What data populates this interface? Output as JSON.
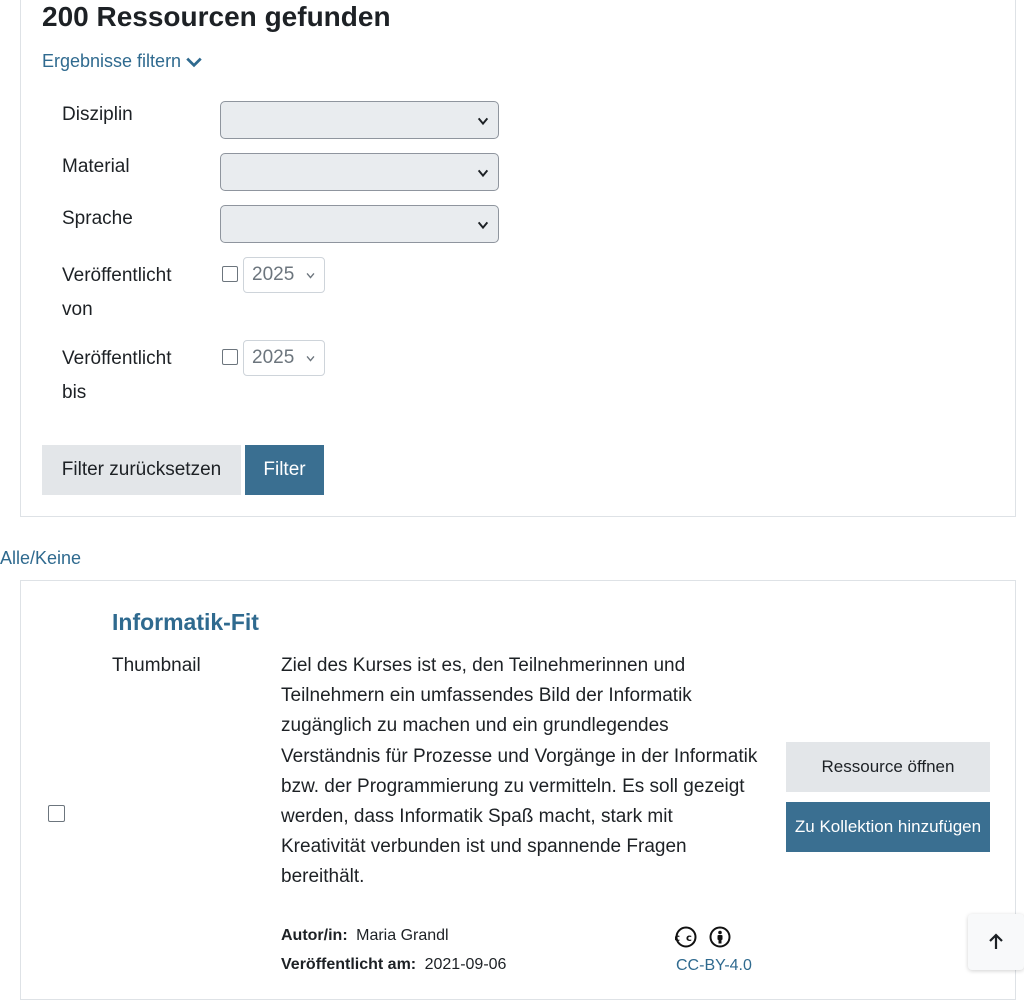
{
  "filters": {
    "results_count_title": "200 Ressourcen gefunden",
    "toggle_label": "Ergebnisse filtern",
    "discipline_label": "Disziplin",
    "material_label": "Material",
    "language_label": "Sprache",
    "published_from_label_line1": "Veröffentlicht",
    "published_from_label_line2": "von",
    "published_from_year": "2025",
    "published_until_label_line1": "Veröffentlicht",
    "published_until_label_line2": "bis",
    "published_until_year": "2025",
    "reset_button": "Filter zurücksetzen",
    "filter_button": "Filter"
  },
  "select_all_link": "Alle/Keine",
  "resource": {
    "title": "Informatik-Fit",
    "thumbnail_label": "Thumbnail",
    "description": "Ziel des Kurses ist es, den Teilnehmerinnen und Teilnehmern ein umfassendes Bild der Informatik zugänglich zu machen und ein grundlegendes Verständnis für Prozesse und Vorgänge in der Informatik bzw. der Programmierung zu vermitteln. Es soll gezeigt werden, dass Informatik Spaß macht, stark mit Kreativität verbunden ist und spannende Fragen bereithält.",
    "author_label": "Autor/in:",
    "author_value": "Maria Grandl",
    "published_label": "Veröffentlicht am:",
    "published_value": "2021-09-06",
    "license_icons": "🅭 🅯",
    "license_link": "CC-BY-4.0",
    "open_button": "Ressource öffnen",
    "add_collection_button": "Zu Kollektion hinzufügen"
  },
  "colors": {
    "link": "#2f6a8f",
    "primary_button": "#3a6f91",
    "secondary_button": "#e3e6e9"
  },
  "icons": {
    "filter_toggle": "chevron-down-icon",
    "select": "chevron-down-icon",
    "back_to_top": "arrow-up-icon"
  }
}
